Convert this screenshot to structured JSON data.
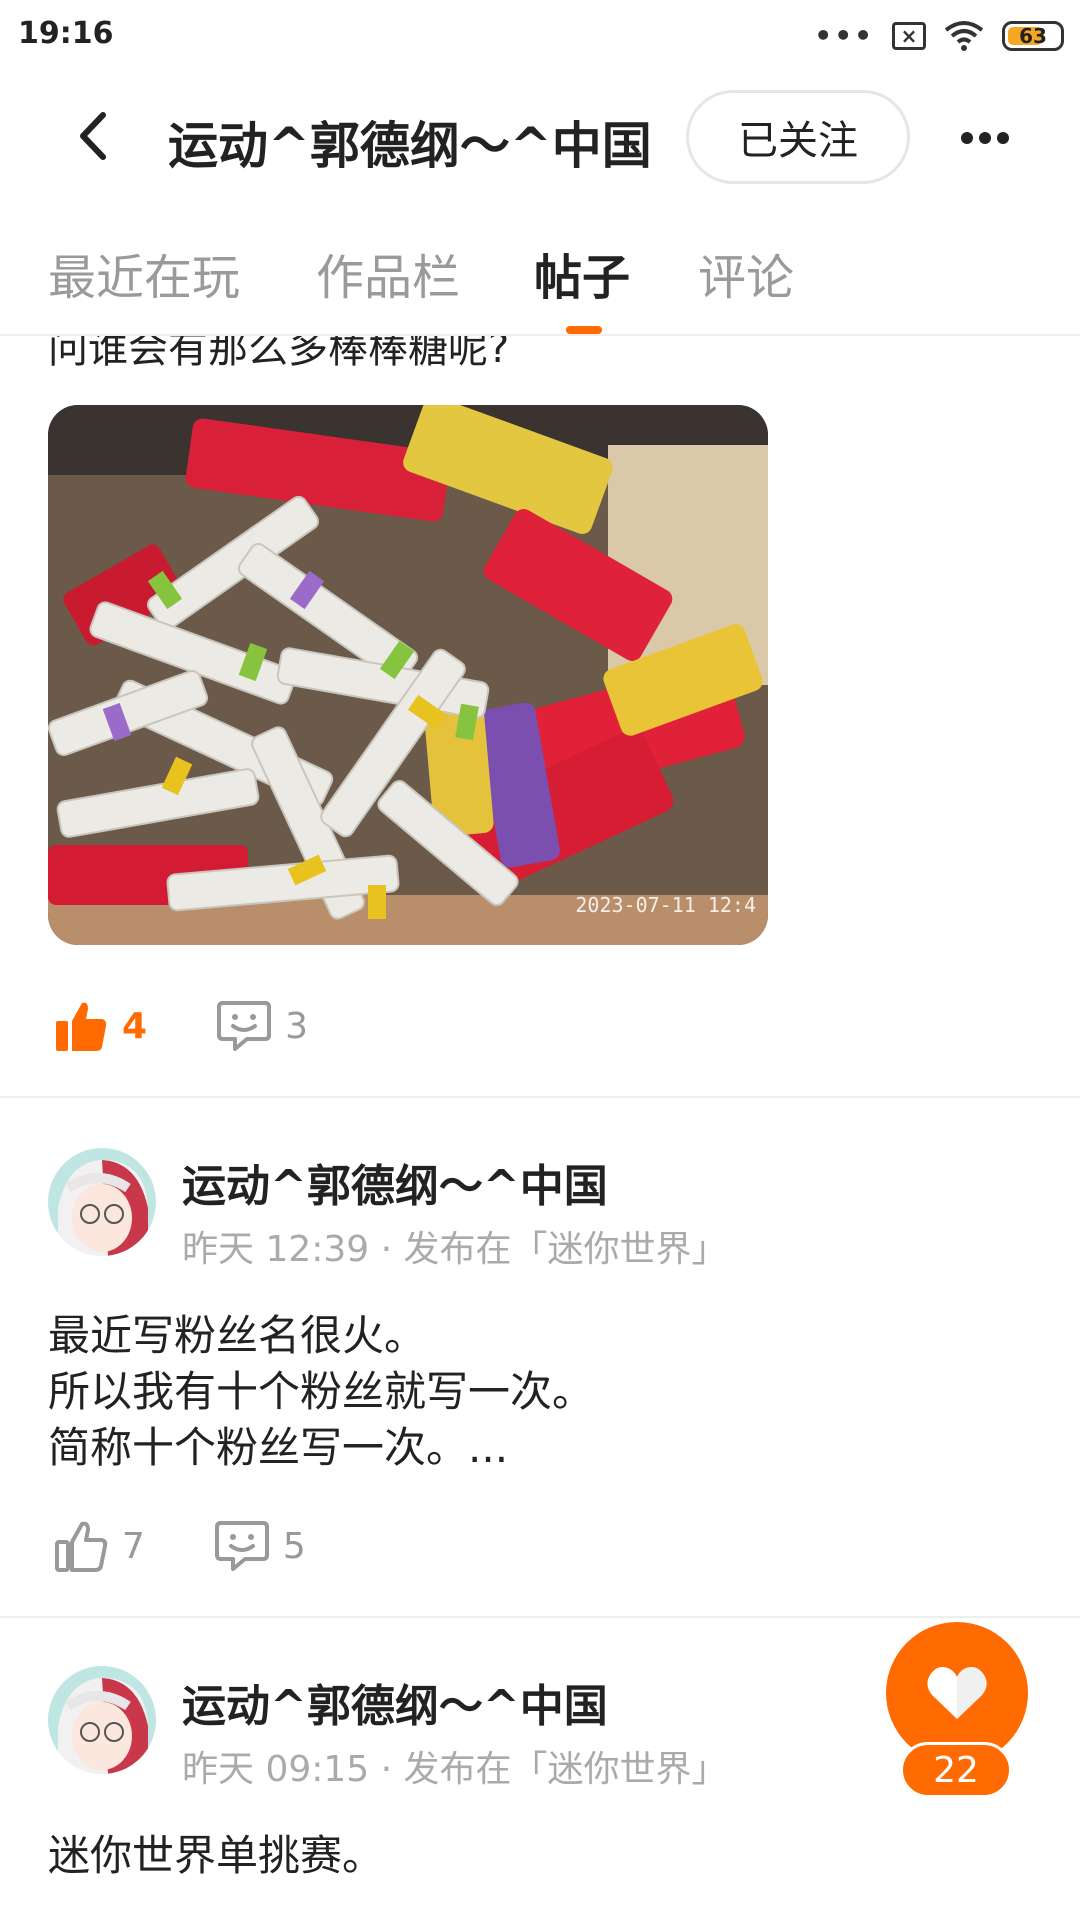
{
  "status_bar": {
    "time": "19:16",
    "battery": "63",
    "icons": [
      "more-dots-icon",
      "sim-off-icon",
      "wifi-icon",
      "battery-icon"
    ]
  },
  "header": {
    "title": "运动^郭德纲～^中国",
    "follow_label": "已关注"
  },
  "tabs": [
    {
      "label": "最近在玩",
      "active": false
    },
    {
      "label": "作品栏",
      "active": false
    },
    {
      "label": "帖子",
      "active": true
    },
    {
      "label": "评论",
      "active": false
    }
  ],
  "colors": {
    "accent": "#ff6b00",
    "muted": "#999999"
  },
  "posts": [
    {
      "text_partial": "问谁会有那么多棒棒糖呢?",
      "image_timestamp": "2023-07-11 12:4",
      "likes": "4",
      "comments": "3",
      "liked": true
    },
    {
      "author": "运动^郭德纲～^中国",
      "meta": "昨天 12:39 · 发布在「迷你世界」",
      "lines": [
        "最近写粉丝名很火。",
        "所以我有十个粉丝就写一次。",
        "简称十个粉丝写一次。..."
      ],
      "likes": "7",
      "comments": "5",
      "liked": false
    },
    {
      "author": "运动^郭德纲～^中国",
      "meta": "昨天 09:15 · 发布在「迷你世界」",
      "lines": [
        "迷你世界单挑赛。"
      ]
    }
  ],
  "fab": {
    "count": "22",
    "icon": "heart-icon"
  }
}
